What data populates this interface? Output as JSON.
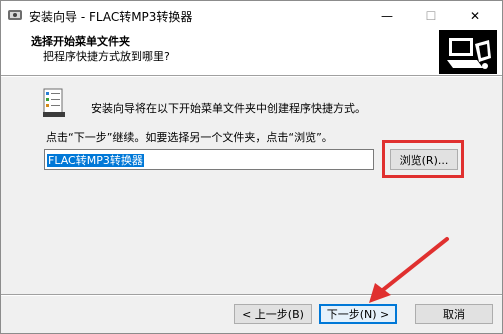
{
  "window": {
    "title": "安装向导 - FLAC转MP3转换器",
    "minimize_glyph": "—",
    "maximize_glyph": "☐",
    "close_glyph": "✕"
  },
  "header": {
    "title": "选择开始菜单文件夹",
    "subtitle": "把程序快捷方式放到哪里?"
  },
  "body": {
    "line1": "安装向导将在以下开始菜单文件夹中创建程序快捷方式。",
    "line2": "点击“下一步”继续。如要选择另一个文件夹，点击“浏览”。",
    "folder_value": "FLAC转MP3转换器",
    "browse_label": "浏览(R)..."
  },
  "footer": {
    "back_label": "< 上一步(B)",
    "next_label": "下一步(N) >",
    "cancel_label": "取消"
  },
  "colors": {
    "highlight": "#e0302f",
    "accent": "#0078d7"
  },
  "icons": [
    "app-icon",
    "minimize-icon",
    "maximize-icon",
    "close-icon",
    "wizard-computer-icon",
    "start-menu-folder-icon",
    "annotation-arrow"
  ]
}
